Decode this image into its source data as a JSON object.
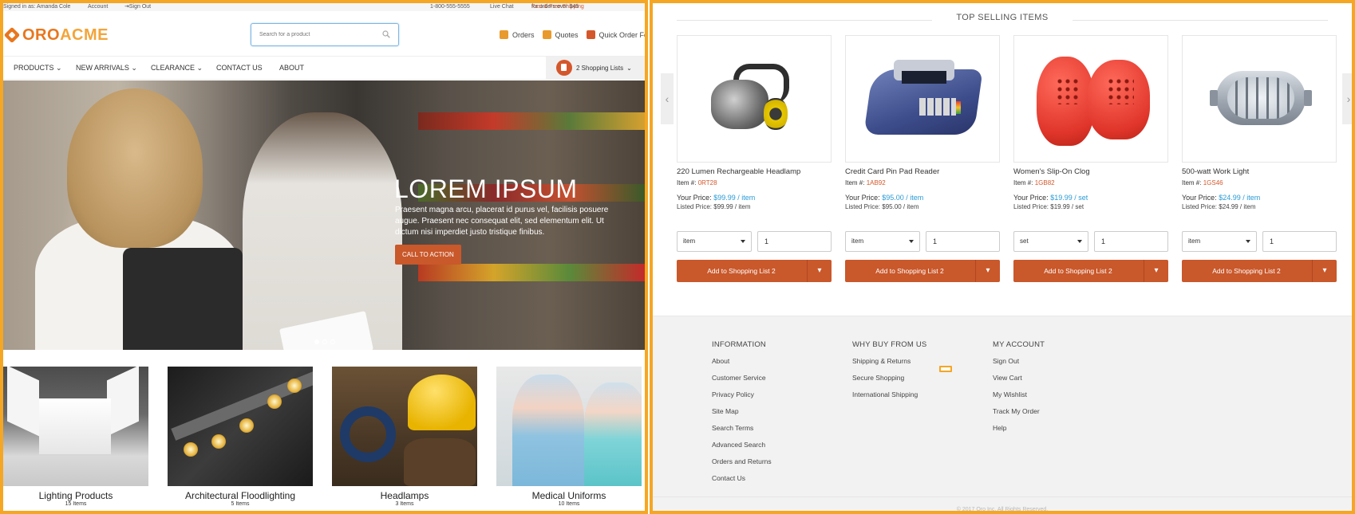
{
  "topbar": {
    "signed_in": "Signed in as: Amanda Cole",
    "account": "Account",
    "sign_out": "Sign Out",
    "phone": "1-800-555-5555",
    "live_chat": "Live Chat",
    "shipping_highlight": "Fast & Free Shipping",
    "shipping_rest": "for orders over $45"
  },
  "brand": {
    "logo_a": "ORO",
    "logo_b": "ACME"
  },
  "search": {
    "placeholder": "Search for a product"
  },
  "util": {
    "orders": "Orders",
    "quotes": "Quotes",
    "quick_order": "Quick Order Form"
  },
  "nav": {
    "items": [
      "PRODUCTS",
      "NEW ARRIVALS",
      "CLEARANCE",
      "CONTACT US",
      "ABOUT"
    ],
    "shopping_lists": "2 Shopping Lists"
  },
  "hero": {
    "title": "LOREM IPSUM",
    "text": "Praesent magna arcu, placerat id purus vel, facilisis posuere augue. Praesent nec consequat elit, sed elementum elit. Ut dictum nisi imperdiet justo tristique finibus.",
    "cta": "CALL TO ACTION"
  },
  "categories": [
    {
      "name": "Lighting Products",
      "count": "15 Items"
    },
    {
      "name": "Architectural Floodlighting",
      "count": "5 Items"
    },
    {
      "name": "Headlamps",
      "count": "3 Items"
    },
    {
      "name": "Medical Uniforms",
      "count": "10 Items"
    }
  ],
  "top_selling": {
    "title": "TOP SELLING ITEMS",
    "products": [
      {
        "name": "220 Lumen Rechargeable Headlamp",
        "item_label": "Item #:",
        "sku": "0RT28",
        "your_price_label": "Your Price:",
        "price": "$99.99",
        "per": "/ item",
        "listed": "Listed Price: $99.99 / item",
        "unit": "item",
        "qty": "1",
        "button": "Add to Shopping List 2"
      },
      {
        "name": "Credit Card Pin Pad Reader",
        "item_label": "Item #:",
        "sku": "1AB92",
        "your_price_label": "Your Price:",
        "price": "$95.00",
        "per": "/ item",
        "listed": "Listed Price: $95.00 / item",
        "unit": "item",
        "qty": "1",
        "button": "Add to Shopping List 2"
      },
      {
        "name": "Women's Slip-On Clog",
        "item_label": "Item #:",
        "sku": "1GB82",
        "your_price_label": "Your Price:",
        "price": "$19.99",
        "per": "/ set",
        "listed": "Listed Price: $19.99 / set",
        "unit": "set",
        "qty": "1",
        "button": "Add to Shopping List 2"
      },
      {
        "name": "500-watt Work Light",
        "item_label": "Item #:",
        "sku": "1GS46",
        "your_price_label": "Your Price:",
        "price": "$24.99",
        "per": "/ item",
        "listed": "Listed Price: $24.99 / item",
        "unit": "item",
        "qty": "1",
        "button": "Add to Shopping List 2"
      }
    ]
  },
  "footer": {
    "information": {
      "title": "INFORMATION",
      "links": [
        "About",
        "Customer Service",
        "Privacy Policy",
        "Site Map",
        "Search Terms",
        "Advanced Search",
        "Orders and Returns",
        "Contact Us"
      ]
    },
    "why_buy": {
      "title": "WHY BUY FROM US",
      "links": [
        "Shipping & Returns",
        "Secure Shopping",
        "International Shipping"
      ]
    },
    "my_account": {
      "title": "MY ACCOUNT",
      "links": [
        "Sign Out",
        "View Cart",
        "My Wishlist",
        "Track My Order",
        "Help"
      ]
    },
    "copyright": "© 2017 Oro Inc. All Rights Reserved."
  },
  "colors": {
    "accent": "#c9582b",
    "brand_orange": "#e8761e",
    "price_blue": "#2a9bd6",
    "frame": "#f5a623"
  },
  "icons": [
    "user-icon",
    "search-icon",
    "orders-icon",
    "quotes-icon",
    "quick-order-icon",
    "shopping-list-icon",
    "chevron-left-icon",
    "chevron-right-icon",
    "caret-down-icon"
  ]
}
